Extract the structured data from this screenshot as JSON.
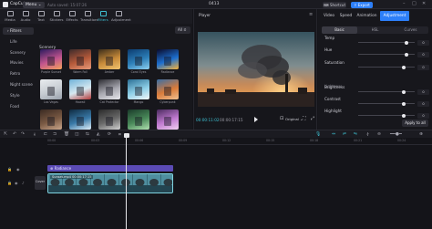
{
  "app": {
    "name": "CapCut",
    "menu_label": "Menu ⌄",
    "autosave": "Auto saved: 15:07:26",
    "project_title": "0413",
    "shortcut_label": "⌨ Shortcut",
    "export_label": "⇪ Export"
  },
  "tool_tabs": [
    {
      "label": "Media",
      "active": false
    },
    {
      "label": "Audio",
      "active": false
    },
    {
      "label": "Text",
      "active": false
    },
    {
      "label": "Stickers",
      "active": false
    },
    {
      "label": "Effects",
      "active": false
    },
    {
      "label": "Transitions",
      "active": false
    },
    {
      "label": "Filters",
      "active": true
    },
    {
      "label": "Adjustment",
      "active": false
    }
  ],
  "sidebar": {
    "items": [
      {
        "label": "› Filters",
        "active": true
      },
      {
        "label": "Life",
        "active": false
      },
      {
        "label": "Scenery",
        "active": false
      },
      {
        "label": "Movies",
        "active": false
      },
      {
        "label": "Retro",
        "active": false
      },
      {
        "label": "Night scene",
        "active": false
      },
      {
        "label": "Style",
        "active": false
      },
      {
        "label": "Food",
        "active": false
      }
    ]
  },
  "grid": {
    "all_label": "All ⚟",
    "section_label": "Scenery",
    "thumbs": [
      {
        "label": "Purple Sunset",
        "colors": [
          "#2a1a5e",
          "#c2558e",
          "#f4a25c"
        ]
      },
      {
        "label": "Warm Fall",
        "colors": [
          "#3b2a2a",
          "#b55a3a",
          "#e79a7a"
        ]
      },
      {
        "label": "Amber",
        "colors": [
          "#3a2c1a",
          "#c88b3a",
          "#f1c470"
        ]
      },
      {
        "label": "Coral Eyes",
        "colors": [
          "#0b3a6e",
          "#2d7fb8",
          "#8ed0f0"
        ]
      },
      {
        "label": "Radiance",
        "colors": [
          "#0a0a2a",
          "#1d6fcf",
          "#f5b23a"
        ]
      },
      {
        "label": "Las Vegas",
        "colors": [
          "#e9ecef",
          "#c7ccd2",
          "#9aa2ad"
        ]
      },
      {
        "label": "Hawaii",
        "colors": [
          "#6fb2d8",
          "#d6e8f0",
          "#b53a3a"
        ]
      },
      {
        "label": "Cat Protector",
        "colors": [
          "#2c2c32",
          "#a8a8b0",
          "#e7e7ec"
        ]
      },
      {
        "label": "Mango",
        "colors": [
          "#2b6f95",
          "#8fd0e8",
          "#f2f7fa"
        ]
      },
      {
        "label": "Cyberpunk",
        "colors": [
          "#3a6ea5",
          "#d97b3a",
          "#f0c090"
        ]
      },
      {
        "label": "",
        "colors": [
          "#3a2a22",
          "#7a5a44",
          "#c8a58a"
        ]
      },
      {
        "label": "",
        "colors": [
          "#0f2a40",
          "#3a7aa8",
          "#e0f0fa"
        ]
      },
      {
        "label": "",
        "colors": [
          "#2a2a2a",
          "#6a6a6a",
          "#d0d0d0"
        ]
      },
      {
        "label": "",
        "colors": [
          "#1a3a2a",
          "#4a8a5a",
          "#b0e0b0"
        ]
      },
      {
        "label": "",
        "colors": [
          "#4a2a5e",
          "#c07ad0",
          "#f0d0f0"
        ]
      }
    ]
  },
  "player": {
    "title": "Player",
    "menu": "≡",
    "time_current": "00:00:11:02",
    "time_total": "00:00:17:15",
    "controls": [
      "⊡",
      "Original ⌄",
      "⛶",
      "⤢"
    ]
  },
  "right_panel": {
    "tabs": [
      {
        "label": "Video",
        "active": false
      },
      {
        "label": "Speed",
        "active": false
      },
      {
        "label": "Animation",
        "active": false
      },
      {
        "label": "Adjustment",
        "active": true
      }
    ],
    "subtabs": [
      {
        "label": "Basic",
        "active": true
      },
      {
        "label": "HSL",
        "active": false
      },
      {
        "label": "Curves",
        "active": false
      }
    ],
    "params": [
      {
        "label": "Temp",
        "value": "0",
        "level": 0.85
      },
      {
        "label": "Hue",
        "value": "0",
        "level": 0.85
      },
      {
        "label": "Saturation",
        "value": "0",
        "level": 0.8
      },
      {
        "label": "Brightness",
        "value": "0",
        "level": 0.8
      },
      {
        "label": "Contrast",
        "value": "0",
        "level": 0.8
      },
      {
        "label": "Highlight",
        "value": "0",
        "level": 0.8
      }
    ],
    "group_label": "Lightness",
    "apply_label": "Apply to all"
  },
  "timeline": {
    "ruler": [
      "00:00",
      "00:03",
      "00:06",
      "00:09",
      "00:12",
      "00:15",
      "00:18",
      "00:21",
      "00:24"
    ],
    "filter_clip_label": "⊕ Radiance",
    "video_clip_label": "Sunset.mp4  00:00:17:15",
    "cover_label": "Cover"
  },
  "colors": {
    "accent": "#3ec1d3",
    "export": "#2d7ff9",
    "filter_clip": "#5b4bb5",
    "video_clip_border": "#7fd3df"
  }
}
